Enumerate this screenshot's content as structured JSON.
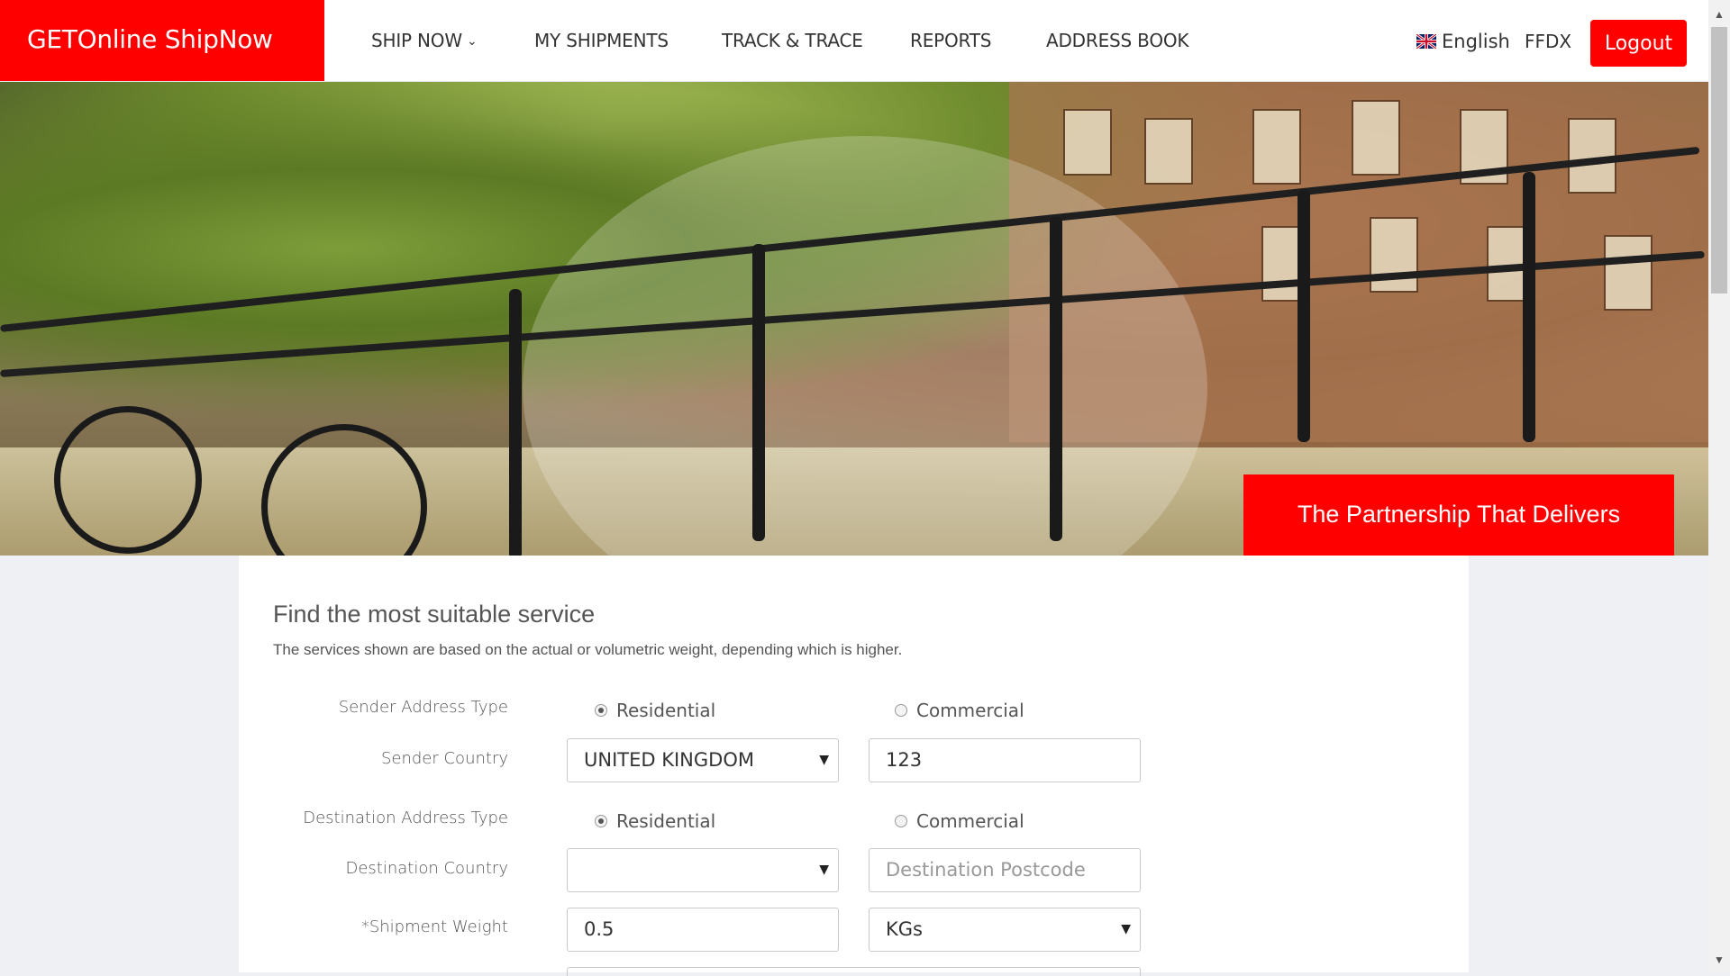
{
  "brand": "GETOnline ShipNow",
  "nav": [
    {
      "label": "SHIP NOW",
      "has_dropdown": true
    },
    {
      "label": "MY SHIPMENTS"
    },
    {
      "label": "TRACK & TRACE"
    },
    {
      "label": "REPORTS"
    },
    {
      "label": "ADDRESS BOOK"
    }
  ],
  "header": {
    "language": "English",
    "user": "FFDX",
    "logout": "Logout"
  },
  "hero": {
    "tagline": "The Partnership That Delivers"
  },
  "form": {
    "title": "Find the most suitable service",
    "subtitle": "The services shown are based on the actual or volumetric weight, depending which is higher.",
    "sender_address_type_label": "Sender Address Type",
    "residential": "Residential",
    "commercial": "Commercial",
    "sender_address_type_selected": "Residential",
    "sender_country_label": "Sender Country",
    "sender_country_value": "UNITED KINGDOM",
    "sender_postcode_value": "123",
    "destination_address_type_label": "Destination Address Type",
    "destination_address_type_selected": "Residential",
    "destination_country_label": "Destination Country",
    "destination_country_value": "",
    "destination_postcode_placeholder": "Destination Postcode",
    "shipment_weight_label": "*Shipment Weight",
    "shipment_weight_value": "0.5",
    "weight_unit_value": "KGs"
  },
  "colors": {
    "brand_red": "#ff0000",
    "background": "#eef0f3"
  }
}
